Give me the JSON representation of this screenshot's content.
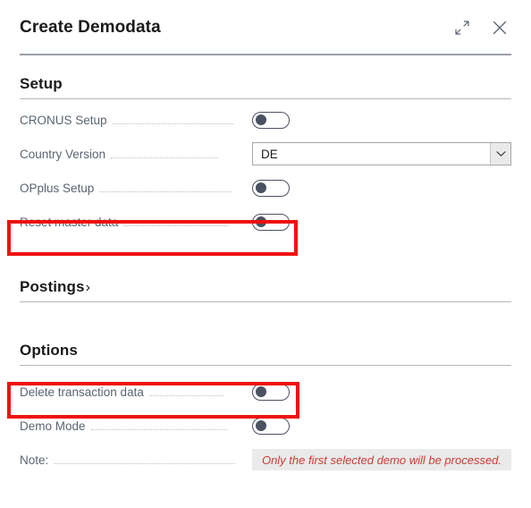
{
  "dialog": {
    "title": "Create Demodata",
    "expand_icon": "expand-diagonal-icon",
    "close_icon": "close-icon"
  },
  "sections": [
    {
      "id": "setup",
      "title": "Setup",
      "collapsed": false,
      "chevron": ""
    },
    {
      "id": "postings",
      "title": "Postings",
      "collapsed": true,
      "chevron": "›"
    },
    {
      "id": "options",
      "title": "Options",
      "collapsed": false,
      "chevron": ""
    }
  ],
  "setup_fields": [
    {
      "label": "CRONUS Setup",
      "type": "toggle",
      "value": "off",
      "highlighted": false
    },
    {
      "label": "Country Version",
      "type": "select",
      "value": "DE",
      "highlighted": false
    },
    {
      "label": "OPplus Setup",
      "type": "toggle",
      "value": "off",
      "highlighted": false
    },
    {
      "label": "Reset master data",
      "type": "toggle",
      "value": "off",
      "highlighted": true
    }
  ],
  "options_fields": [
    {
      "label": "Delete transaction data",
      "type": "toggle",
      "value": "off",
      "highlighted": true
    },
    {
      "label": "Demo Mode",
      "type": "toggle",
      "value": "off",
      "highlighted": false
    },
    {
      "label": "Note:",
      "type": "readonly-note",
      "value": "Only the first selected demo will be processed.",
      "highlighted": false
    }
  ],
  "colors": {
    "highlight": "#EE1111",
    "note_text": "#CB3B33",
    "label": "#5A6472",
    "toggle": "#4A5262"
  }
}
